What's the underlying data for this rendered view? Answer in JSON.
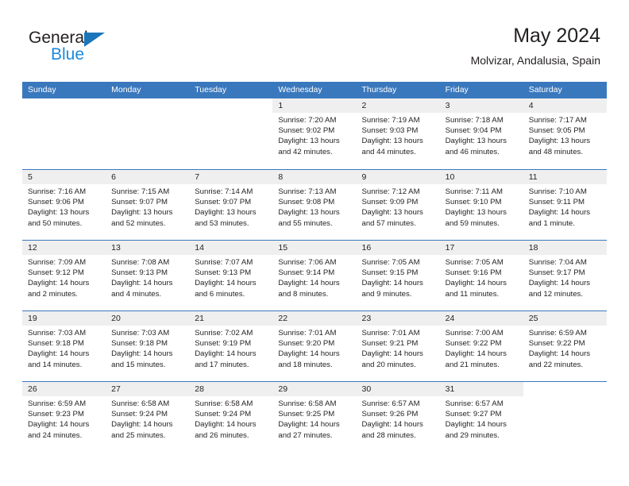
{
  "brand": {
    "name_top": "General",
    "name_bottom": "Blue",
    "accent_color": "#1b8ade",
    "triangle_color": "#1b75bb"
  },
  "header": {
    "title": "May 2024",
    "subtitle": "Molvizar, Andalusia, Spain"
  },
  "theme": {
    "header_row_bg": "#3a78bd",
    "daynum_strip_bg": "#efefef",
    "row_divider": "#3a78bd",
    "text": "#231f20"
  },
  "weekdays": [
    "Sunday",
    "Monday",
    "Tuesday",
    "Wednesday",
    "Thursday",
    "Friday",
    "Saturday"
  ],
  "weeks": [
    [
      {
        "day": "",
        "blank": true,
        "lines": []
      },
      {
        "day": "",
        "blank": true,
        "lines": []
      },
      {
        "day": "",
        "blank": true,
        "lines": []
      },
      {
        "day": "1",
        "lines": [
          "Sunrise: 7:20 AM",
          "Sunset: 9:02 PM",
          "Daylight: 13 hours",
          "and 42 minutes."
        ]
      },
      {
        "day": "2",
        "lines": [
          "Sunrise: 7:19 AM",
          "Sunset: 9:03 PM",
          "Daylight: 13 hours",
          "and 44 minutes."
        ]
      },
      {
        "day": "3",
        "lines": [
          "Sunrise: 7:18 AM",
          "Sunset: 9:04 PM",
          "Daylight: 13 hours",
          "and 46 minutes."
        ]
      },
      {
        "day": "4",
        "lines": [
          "Sunrise: 7:17 AM",
          "Sunset: 9:05 PM",
          "Daylight: 13 hours",
          "and 48 minutes."
        ]
      }
    ],
    [
      {
        "day": "5",
        "lines": [
          "Sunrise: 7:16 AM",
          "Sunset: 9:06 PM",
          "Daylight: 13 hours",
          "and 50 minutes."
        ]
      },
      {
        "day": "6",
        "lines": [
          "Sunrise: 7:15 AM",
          "Sunset: 9:07 PM",
          "Daylight: 13 hours",
          "and 52 minutes."
        ]
      },
      {
        "day": "7",
        "lines": [
          "Sunrise: 7:14 AM",
          "Sunset: 9:07 PM",
          "Daylight: 13 hours",
          "and 53 minutes."
        ]
      },
      {
        "day": "8",
        "lines": [
          "Sunrise: 7:13 AM",
          "Sunset: 9:08 PM",
          "Daylight: 13 hours",
          "and 55 minutes."
        ]
      },
      {
        "day": "9",
        "lines": [
          "Sunrise: 7:12 AM",
          "Sunset: 9:09 PM",
          "Daylight: 13 hours",
          "and 57 minutes."
        ]
      },
      {
        "day": "10",
        "lines": [
          "Sunrise: 7:11 AM",
          "Sunset: 9:10 PM",
          "Daylight: 13 hours",
          "and 59 minutes."
        ]
      },
      {
        "day": "11",
        "lines": [
          "Sunrise: 7:10 AM",
          "Sunset: 9:11 PM",
          "Daylight: 14 hours",
          "and 1 minute."
        ]
      }
    ],
    [
      {
        "day": "12",
        "lines": [
          "Sunrise: 7:09 AM",
          "Sunset: 9:12 PM",
          "Daylight: 14 hours",
          "and 2 minutes."
        ]
      },
      {
        "day": "13",
        "lines": [
          "Sunrise: 7:08 AM",
          "Sunset: 9:13 PM",
          "Daylight: 14 hours",
          "and 4 minutes."
        ]
      },
      {
        "day": "14",
        "lines": [
          "Sunrise: 7:07 AM",
          "Sunset: 9:13 PM",
          "Daylight: 14 hours",
          "and 6 minutes."
        ]
      },
      {
        "day": "15",
        "lines": [
          "Sunrise: 7:06 AM",
          "Sunset: 9:14 PM",
          "Daylight: 14 hours",
          "and 8 minutes."
        ]
      },
      {
        "day": "16",
        "lines": [
          "Sunrise: 7:05 AM",
          "Sunset: 9:15 PM",
          "Daylight: 14 hours",
          "and 9 minutes."
        ]
      },
      {
        "day": "17",
        "lines": [
          "Sunrise: 7:05 AM",
          "Sunset: 9:16 PM",
          "Daylight: 14 hours",
          "and 11 minutes."
        ]
      },
      {
        "day": "18",
        "lines": [
          "Sunrise: 7:04 AM",
          "Sunset: 9:17 PM",
          "Daylight: 14 hours",
          "and 12 minutes."
        ]
      }
    ],
    [
      {
        "day": "19",
        "lines": [
          "Sunrise: 7:03 AM",
          "Sunset: 9:18 PM",
          "Daylight: 14 hours",
          "and 14 minutes."
        ]
      },
      {
        "day": "20",
        "lines": [
          "Sunrise: 7:03 AM",
          "Sunset: 9:18 PM",
          "Daylight: 14 hours",
          "and 15 minutes."
        ]
      },
      {
        "day": "21",
        "lines": [
          "Sunrise: 7:02 AM",
          "Sunset: 9:19 PM",
          "Daylight: 14 hours",
          "and 17 minutes."
        ]
      },
      {
        "day": "22",
        "lines": [
          "Sunrise: 7:01 AM",
          "Sunset: 9:20 PM",
          "Daylight: 14 hours",
          "and 18 minutes."
        ]
      },
      {
        "day": "23",
        "lines": [
          "Sunrise: 7:01 AM",
          "Sunset: 9:21 PM",
          "Daylight: 14 hours",
          "and 20 minutes."
        ]
      },
      {
        "day": "24",
        "lines": [
          "Sunrise: 7:00 AM",
          "Sunset: 9:22 PM",
          "Daylight: 14 hours",
          "and 21 minutes."
        ]
      },
      {
        "day": "25",
        "lines": [
          "Sunrise: 6:59 AM",
          "Sunset: 9:22 PM",
          "Daylight: 14 hours",
          "and 22 minutes."
        ]
      }
    ],
    [
      {
        "day": "26",
        "lines": [
          "Sunrise: 6:59 AM",
          "Sunset: 9:23 PM",
          "Daylight: 14 hours",
          "and 24 minutes."
        ]
      },
      {
        "day": "27",
        "lines": [
          "Sunrise: 6:58 AM",
          "Sunset: 9:24 PM",
          "Daylight: 14 hours",
          "and 25 minutes."
        ]
      },
      {
        "day": "28",
        "lines": [
          "Sunrise: 6:58 AM",
          "Sunset: 9:24 PM",
          "Daylight: 14 hours",
          "and 26 minutes."
        ]
      },
      {
        "day": "29",
        "lines": [
          "Sunrise: 6:58 AM",
          "Sunset: 9:25 PM",
          "Daylight: 14 hours",
          "and 27 minutes."
        ]
      },
      {
        "day": "30",
        "lines": [
          "Sunrise: 6:57 AM",
          "Sunset: 9:26 PM",
          "Daylight: 14 hours",
          "and 28 minutes."
        ]
      },
      {
        "day": "31",
        "lines": [
          "Sunrise: 6:57 AM",
          "Sunset: 9:27 PM",
          "Daylight: 14 hours",
          "and 29 minutes."
        ]
      },
      {
        "day": "",
        "blank": true,
        "lines": []
      }
    ]
  ]
}
